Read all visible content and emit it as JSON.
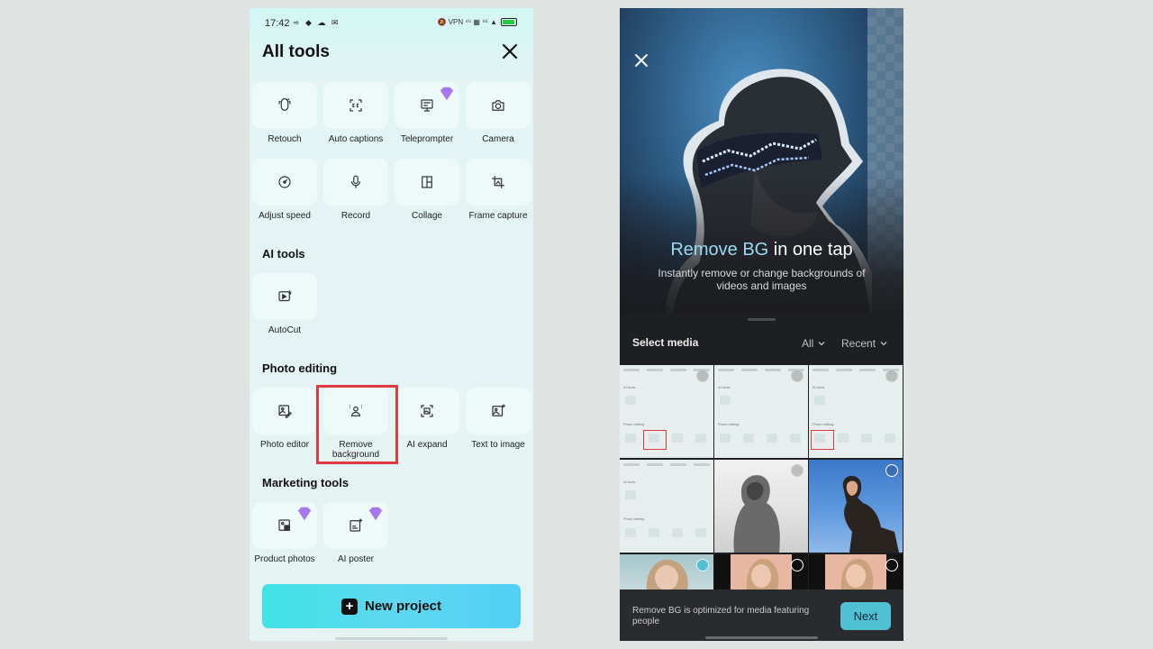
{
  "left": {
    "status": {
      "time": "17:42",
      "left_icons": "➾ ◆ ☁ ✉",
      "right_text": "🔕 VPN ⁴⁶ ▦ ⁴⁶ ▲"
    },
    "title": "All tools",
    "tools": [
      {
        "label": "Retouch",
        "icon": "retouch-icon"
      },
      {
        "label": "Auto captions",
        "icon": "captions-icon"
      },
      {
        "label": "Teleprompter",
        "icon": "teleprompter-icon",
        "premium": true
      },
      {
        "label": "Camera",
        "icon": "camera-icon"
      },
      {
        "label": "Adjust speed",
        "icon": "speed-icon"
      },
      {
        "label": "Record",
        "icon": "microphone-icon"
      },
      {
        "label": "Collage",
        "icon": "collage-icon"
      },
      {
        "label": "Frame capture",
        "icon": "frame-capture-icon"
      }
    ],
    "ai_tools": {
      "title": "AI tools",
      "items": [
        {
          "label": "AutoCut",
          "icon": "autocut-icon"
        }
      ]
    },
    "photo_editing": {
      "title": "Photo editing",
      "items": [
        {
          "label": "Photo editor",
          "icon": "photo-editor-icon"
        },
        {
          "label": "Remove background",
          "icon": "remove-background-icon",
          "highlighted": true
        },
        {
          "label": "AI expand",
          "icon": "ai-expand-icon"
        },
        {
          "label": "Text to image",
          "icon": "text-to-image-icon"
        }
      ]
    },
    "marketing_tools": {
      "title": "Marketing tools",
      "items": [
        {
          "label": "Product photos",
          "icon": "product-photos-icon",
          "premium": true
        },
        {
          "label": "AI poster",
          "icon": "ai-poster-icon",
          "premium": true
        }
      ]
    },
    "new_project_label": "New project",
    "colors": {
      "accent_start": "#3fe2e5",
      "accent_end": "#52cff5",
      "highlight": "#e0393e",
      "premium": "#a678f0"
    }
  },
  "right": {
    "hero": {
      "title_accent": "Remove BG",
      "title_rest": " in one tap",
      "subtitle": "Instantly remove or change backgrounds of videos and images"
    },
    "sheet": {
      "title": "Select media",
      "filter_type": "All",
      "filter_sort": "Recent"
    },
    "footer_text": "Remove BG is optimized for media featuring people",
    "next_label": "Next",
    "colors": {
      "accent": "#9ad9f3",
      "next_button": "#4fc1d3"
    }
  }
}
